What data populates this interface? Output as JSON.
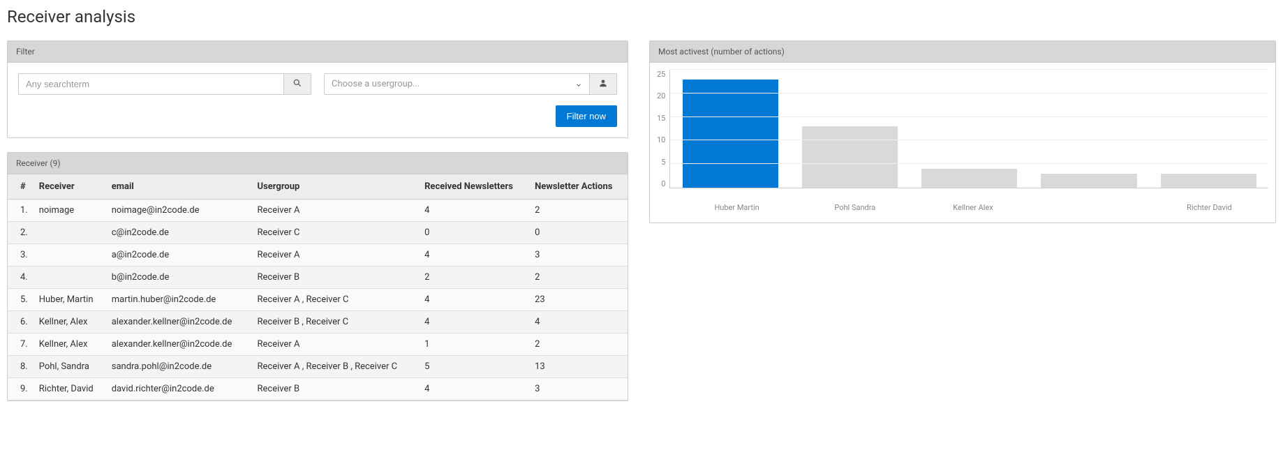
{
  "page_title": "Receiver analysis",
  "filter": {
    "title": "Filter",
    "search_placeholder": "Any searchterm",
    "usergroup_placeholder": "Choose a usergroup...",
    "submit_label": "Filter now"
  },
  "table": {
    "title": "Receiver (9)",
    "columns": {
      "num": "#",
      "receiver": "Receiver",
      "email": "email",
      "usergroup": "Usergroup",
      "received": "Received Newsletters",
      "actions": "Newsletter Actions"
    },
    "rows": [
      {
        "num": "1.",
        "receiver": "noimage",
        "email": "noimage@in2code.de",
        "usergroup": "Receiver A",
        "received": "4",
        "actions": "2"
      },
      {
        "num": "2.",
        "receiver": "",
        "email": "c@in2code.de",
        "usergroup": "Receiver C",
        "received": "0",
        "actions": "0"
      },
      {
        "num": "3.",
        "receiver": "",
        "email": "a@in2code.de",
        "usergroup": "Receiver A",
        "received": "4",
        "actions": "3"
      },
      {
        "num": "4.",
        "receiver": "",
        "email": "b@in2code.de",
        "usergroup": "Receiver B",
        "received": "2",
        "actions": "2"
      },
      {
        "num": "5.",
        "receiver": "Huber, Martin",
        "email": "martin.huber@in2code.de",
        "usergroup": "Receiver A , Receiver C",
        "received": "4",
        "actions": "23"
      },
      {
        "num": "6.",
        "receiver": "Kellner, Alex",
        "email": "alexander.kellner@in2code.de",
        "usergroup": "Receiver B , Receiver C",
        "received": "4",
        "actions": "4"
      },
      {
        "num": "7.",
        "receiver": "Kellner, Alex",
        "email": "alexander.kellner@in2code.de",
        "usergroup": "Receiver A",
        "received": "1",
        "actions": "2"
      },
      {
        "num": "8.",
        "receiver": "Pohl, Sandra",
        "email": "sandra.pohl@in2code.de",
        "usergroup": "Receiver A , Receiver B , Receiver C",
        "received": "5",
        "actions": "13"
      },
      {
        "num": "9.",
        "receiver": "Richter, David",
        "email": "david.richter@in2code.de",
        "usergroup": "Receiver B",
        "received": "4",
        "actions": "3"
      }
    ]
  },
  "chart_panel": {
    "title": "Most activest (number of actions)"
  },
  "chart_data": {
    "type": "bar",
    "categories": [
      "Huber Martin",
      "Pohl Sandra",
      "Kellner Alex",
      "",
      "Richter David"
    ],
    "values": [
      23,
      13,
      4,
      3,
      3
    ],
    "highlight_index": 0,
    "title": "Most activest (number of actions)",
    "xlabel": "",
    "ylabel": "",
    "ylim": [
      0,
      25
    ],
    "y_ticks": [
      25,
      20,
      15,
      10,
      5,
      0
    ]
  },
  "colors": {
    "primary": "#0078d4",
    "bar_default": "#d9d9d9"
  }
}
